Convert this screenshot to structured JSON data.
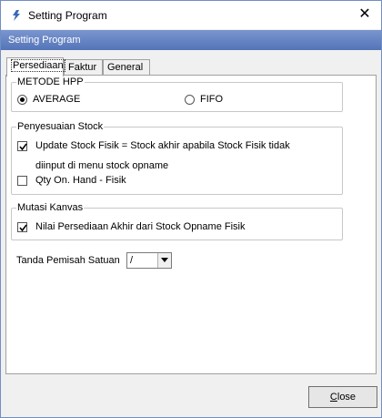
{
  "window": {
    "title": "Setting Program",
    "close_glyph": "✕"
  },
  "panel": {
    "header": "Setting Program"
  },
  "tabs": [
    {
      "label": "Persediaan"
    },
    {
      "label": "Faktur"
    },
    {
      "label": "General"
    }
  ],
  "metode_hpp": {
    "title": "METODE HPP",
    "options": [
      {
        "label": "AVERAGE",
        "selected": true
      },
      {
        "label": "FIFO",
        "selected": false
      }
    ]
  },
  "penyesuaian": {
    "title": "Penyesuaian Stock",
    "update_stock": {
      "label": "Update Stock Fisik = Stock akhir apabila Stock Fisik tidak",
      "label_line2": "diinput di menu stock opname",
      "checked": true
    },
    "qty_on_hand": {
      "label": "Qty On. Hand - Fisik",
      "checked": false
    }
  },
  "mutasi": {
    "title": "Mutasi Kanvas",
    "nilai_persediaan": {
      "label": "Nilai Persediaan Akhir dari Stock Opname Fisik",
      "checked": true
    }
  },
  "separator": {
    "label": "Tanda Pemisah Satuan",
    "value": "/"
  },
  "buttons": {
    "close_first": "C",
    "close_rest": "lose"
  }
}
